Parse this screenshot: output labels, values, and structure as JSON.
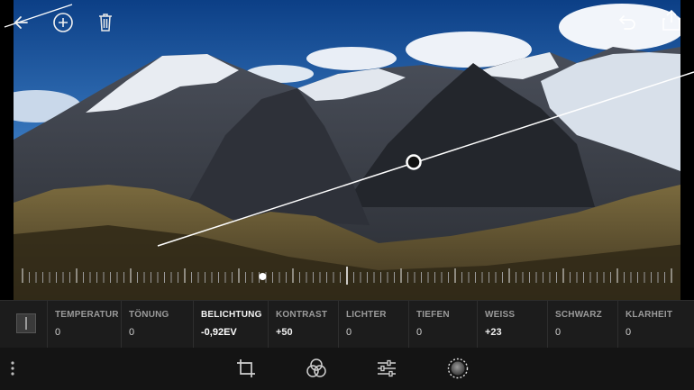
{
  "topbar": {
    "back_icon": "back-arrow-icon",
    "add_icon": "plus-circle-icon",
    "delete_icon": "trash-icon",
    "undo_icon": "undo-icon",
    "share_icon": "share-icon"
  },
  "adjustment": {
    "active": "Belichtung",
    "slider_level_percent": 37
  },
  "sliders": [
    {
      "label": "TEMPERATUR",
      "value": "0"
    },
    {
      "label": "TÖNUNG",
      "value": "0"
    },
    {
      "label": "BELICHTUNG",
      "value": "-0,92EV"
    },
    {
      "label": "KONTRAST",
      "value": "+50"
    },
    {
      "label": "LICHTER",
      "value": "0"
    },
    {
      "label": "TIEFEN",
      "value": "0"
    },
    {
      "label": "WEISS",
      "value": "+23"
    },
    {
      "label": "SCHWARZ",
      "value": "0"
    },
    {
      "label": "KLARHEIT",
      "value": "0"
    }
  ],
  "toolbar": {
    "more_icon": "more-vertical-icon",
    "crop_icon": "crop-icon",
    "presets_icon": "color-circles-icon",
    "adjust_icon": "sliders-icon",
    "selective_icon": "dashed-circle-icon"
  },
  "colors": {
    "panel_background": "#1c1c1c",
    "toolbar_background": "#141414",
    "active_label": "#f4f4f4",
    "inactive_label": "#9b9b9b"
  }
}
